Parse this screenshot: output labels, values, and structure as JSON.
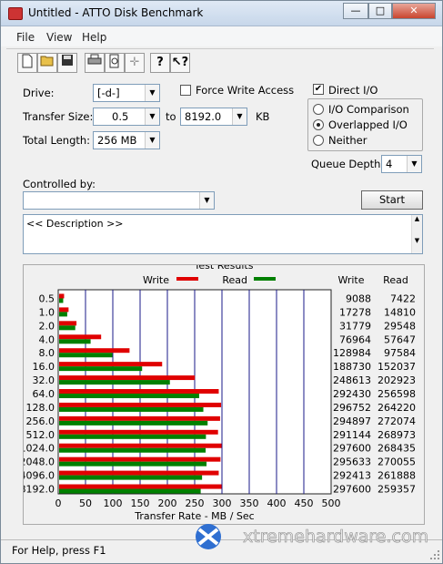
{
  "window": {
    "title": "Untitled - ATTO Disk Benchmark"
  },
  "menu": [
    "File",
    "View",
    "Help"
  ],
  "toolbar_icons": [
    "new-file-icon",
    "open-folder-icon",
    "save-icon",
    "print-icon",
    "print-preview-icon",
    "move-icon",
    "help-icon",
    "context-help-icon"
  ],
  "controls": {
    "drive_label": "Drive:",
    "drive_value": "[-d-]",
    "force_write_label": "Force Write Access",
    "direct_io_label": "Direct I/O",
    "direct_io_checked": true,
    "transfer_size_label": "Transfer Size:",
    "transfer_from": "0.5",
    "to_label": "to",
    "transfer_to": "8192.0",
    "kb_label": "KB",
    "total_length_label": "Total Length:",
    "total_length_value": "256 MB",
    "io_options": [
      "I/O Comparison",
      "Overlapped I/O",
      "Neither"
    ],
    "io_selected": "Overlapped I/O",
    "queue_depth_label": "Queue Depth:",
    "queue_depth_value": "4",
    "controlled_by_label": "Controlled by:",
    "controlled_by_value": "",
    "start_label": "Start",
    "description": "<< Description >>"
  },
  "results": {
    "group_title": "Test Results",
    "legend_write": "Write",
    "legend_read": "Read",
    "col_write": "Write",
    "col_read": "Read",
    "write_color": "#e00000",
    "read_color": "#008000"
  },
  "chart_data": {
    "type": "bar",
    "orientation": "horizontal",
    "categories": [
      "0.5",
      "1.0",
      "2.0",
      "4.0",
      "8.0",
      "16.0",
      "32.0",
      "64.0",
      "128.0",
      "256.0",
      "512.0",
      "1024.0",
      "2048.0",
      "4096.0",
      "8192.0"
    ],
    "series": [
      {
        "name": "Write",
        "values": [
          9088,
          17278,
          31779,
          76964,
          128984,
          188730,
          248613,
          292430,
          296752,
          294897,
          291144,
          297600,
          295633,
          292413,
          297600
        ]
      },
      {
        "name": "Read",
        "values": [
          7422,
          14810,
          29548,
          57647,
          97584,
          152037,
          202923,
          256598,
          264220,
          272074,
          268973,
          268435,
          270055,
          261888,
          259357
        ]
      }
    ],
    "xlabel": "Transfer Rate - MB / Sec",
    "xticks": [
      0,
      50,
      100,
      150,
      200,
      250,
      300,
      350,
      400,
      450,
      500
    ],
    "xlim": [
      0,
      500
    ]
  },
  "status": {
    "help_text": "For Help, press F1"
  },
  "watermark": {
    "text": "xtremehardware.com"
  }
}
